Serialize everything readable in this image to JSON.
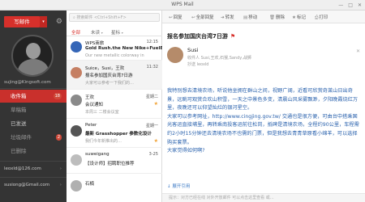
{
  "window": {
    "title": "WPS Mail",
    "controls": [
      "—",
      "□",
      "✕"
    ]
  },
  "sidebar": {
    "compose_label": "写邮件",
    "compose_dropdown": "▾",
    "account_primary": "sujing@Kingsoft.com",
    "folders": [
      {
        "label": "收件箱",
        "active": true,
        "badge": "18"
      },
      {
        "label": "草稿箱",
        "active": false
      },
      {
        "label": "已发送",
        "active": false
      },
      {
        "label": "垃圾邮件",
        "active": false,
        "badge": "2"
      },
      {
        "label": "已删除",
        "active": false
      }
    ],
    "accounts": [
      {
        "label": "leoxld@126.com"
      },
      {
        "label": "susiong@Gmail.com"
      }
    ]
  },
  "list": {
    "search_placeholder": "搜索邮件 <Ctrl+Shift+F>",
    "tabs": [
      {
        "label": "全部",
        "active": true
      },
      {
        "label": "未读",
        "active": false
      },
      {
        "label": "星标",
        "active": false
      }
    ],
    "messages": [
      {
        "sender": "WPS商旅",
        "time": "12:15",
        "subject": "Gold Rush.the New Nike+FuelB",
        "preview": "Our new metallic colorway in",
        "avatar_color": "#3566b7",
        "starred": false
      },
      {
        "sender": "Suice，Susi，王欢",
        "time": "11:32",
        "subject": "报名参加国庆台湾7日游",
        "preview": "大家可以参考一下我们的…",
        "avatar_color": "#c57f63",
        "starred": false
      },
      {
        "sender": "王欢",
        "time": "星期二",
        "subject": "会议通知",
        "preview": "本周三 二楼会议室",
        "avatar_color": "#8a8a8a",
        "starred": true
      },
      {
        "sender": "Peter",
        "time": "星期一",
        "subject": "最新 Grasshopper 参数化设计",
        "preview": "我们今年新推出的…",
        "avatar_color": "#555555",
        "starred": true
      },
      {
        "sender": "suweigang",
        "time": "3-25",
        "subject": "【设计师】招聘职位推荐",
        "preview": "",
        "avatar_color": "#bdbdbd",
        "starred": false
      },
      {
        "sender": "石楠",
        "time": "",
        "subject": "",
        "preview": "",
        "avatar_color": "#b0b0b0",
        "starred": false
      }
    ]
  },
  "reader": {
    "toolbar": [
      {
        "icon": "↩",
        "label": "回复"
      },
      {
        "icon": "↩",
        "label": "全部回复"
      },
      {
        "icon": "➜",
        "label": "转发"
      },
      {
        "icon": "▤",
        "label": "移动"
      },
      {
        "icon": "🗑",
        "label": "删除"
      },
      {
        "icon": "★",
        "label": "标记"
      },
      {
        "icon": "⎙",
        "label": "打印"
      }
    ],
    "subject": "报名参加国庆台湾7日游",
    "flag": "⚑",
    "sender_name": "Susi",
    "recipients": "收件人 Susi,王欢,石猴,Sandy,战狮",
    "cc": "抄送 leoxld",
    "close_icon": "✕",
    "body": [
      "我特别想去清境农场，听说他坐拥在群山之间，视野广阔，近看可欣赏奇莱山日出奇景，远眺可观赏合欢山积雪，一天之中景色多变，清晨山风采雾飘渺，夕阳晚霞烧红万里，夜晚还可以仰望灿烂的银河星空。",
      "大家可以参考网址，http://www.cingjing.gov.tw/ 交通也是很方便，可由台中搭乘国光客运直接埔里，再转乘南投客运前往松岗，抵碑是清境农场，全程约90公里，车程需约2小时15分钟还去清境农场不也需的门票，但是我想去青青草原看小绵羊，可以选择购买套票。",
      "大家觉得如何啊?"
    ],
    "reply_label": "展开引用",
    "footer": "提示：对方已经在线 对外开放邮件 可以点击这里查看 或…"
  }
}
